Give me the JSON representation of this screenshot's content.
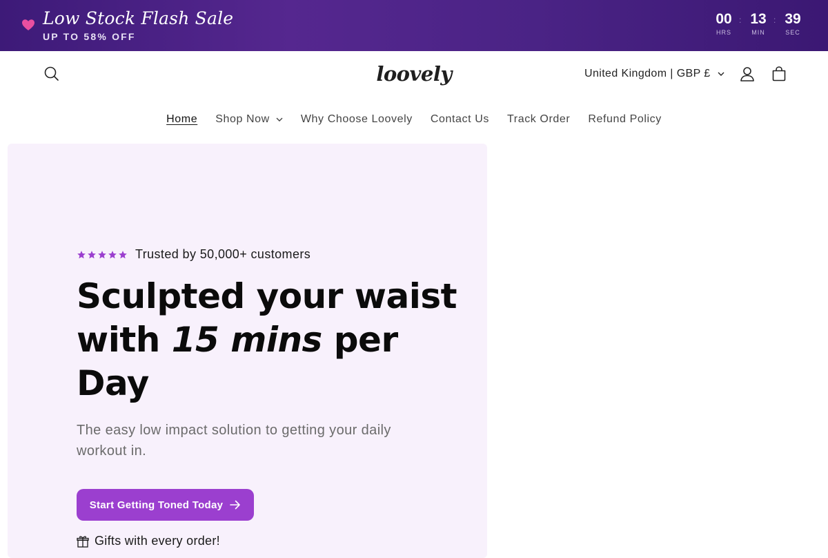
{
  "promo": {
    "title": "Low Stock Flash Sale",
    "subtitle": "UP TO 58% OFF",
    "heart_icon": "heart-icon",
    "timer": [
      {
        "value": "00",
        "label": "HRS"
      },
      {
        "value": "13",
        "label": "MIN"
      },
      {
        "value": "39",
        "label": "SEC"
      }
    ],
    "separator": ":"
  },
  "header": {
    "logo": "loovely",
    "locale": "United Kingdom | GBP £",
    "icons": {
      "search": "search-icon",
      "account": "account-icon",
      "cart": "cart-icon",
      "chevron": "chevron-down-icon"
    }
  },
  "nav": {
    "items": [
      {
        "label": "Home",
        "active": true
      },
      {
        "label": "Shop Now",
        "dropdown": true
      },
      {
        "label": "Why Choose Loovely"
      },
      {
        "label": "Contact Us"
      },
      {
        "label": "Track Order"
      },
      {
        "label": "Refund Policy"
      }
    ]
  },
  "hero": {
    "rating_text": "Trusted by 50,000+ customers",
    "rating_stars": 5,
    "headline_part1": "Sculpted your waist with ",
    "headline_emphasis": "15 mins",
    "headline_part2": " per Day",
    "subtext": "The easy low impact solution to getting your daily workout in.",
    "cta_label": "Start Getting Toned Today",
    "gifts_text": "Gifts with every order!"
  },
  "colors": {
    "promo_bg": "#4a2385",
    "accent": "#9b3fcf",
    "hero_bg": "#f8f1fc",
    "heart": "#e94fa0"
  }
}
